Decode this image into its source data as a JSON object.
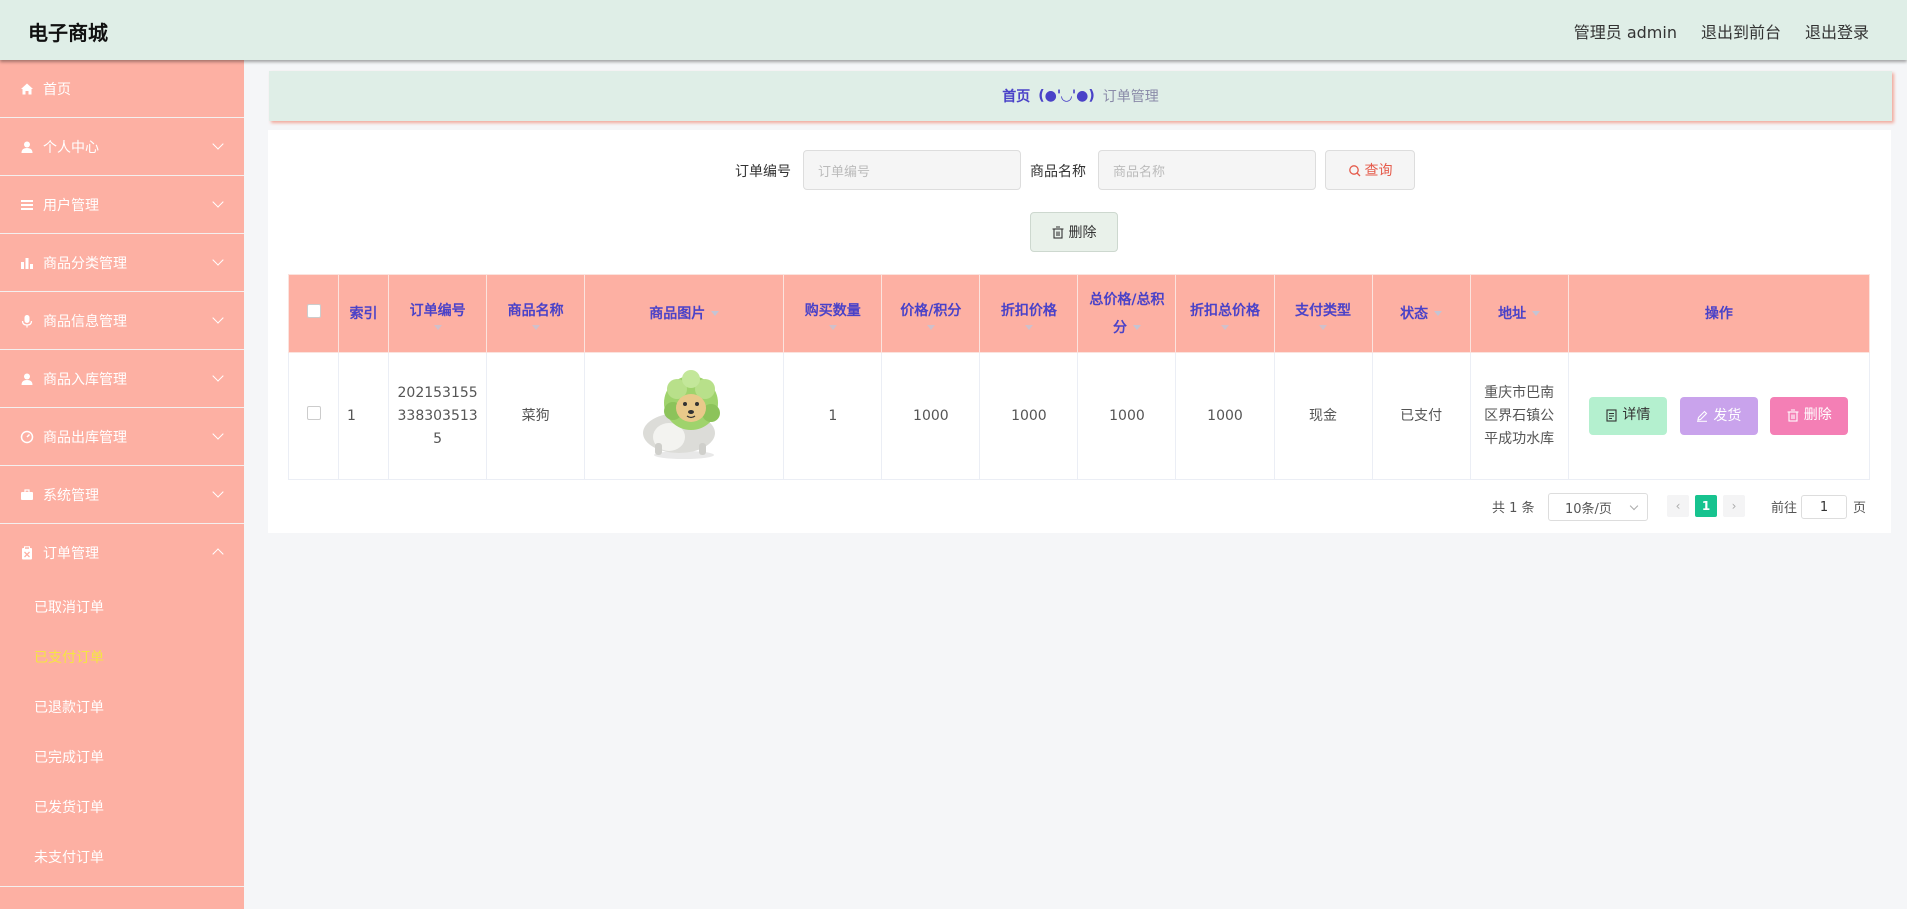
{
  "header": {
    "brand": "电子商城",
    "admin_label": "管理员 admin",
    "to_front_label": "退出到前台",
    "logout_label": "退出登录"
  },
  "sidebar": {
    "items": [
      {
        "label": "首页",
        "icon": "home-icon",
        "has_chevron": false
      },
      {
        "label": "个人中心",
        "icon": "user-icon",
        "has_chevron": true
      },
      {
        "label": "用户管理",
        "icon": "list-icon",
        "has_chevron": true
      },
      {
        "label": "商品分类管理",
        "icon": "bar-chart-icon",
        "has_chevron": true
      },
      {
        "label": "商品信息管理",
        "icon": "microphone-icon",
        "has_chevron": true
      },
      {
        "label": "商品入库管理",
        "icon": "user-icon",
        "has_chevron": true
      },
      {
        "label": "商品出库管理",
        "icon": "gauge-icon",
        "has_chevron": true
      },
      {
        "label": "系统管理",
        "icon": "briefcase-icon",
        "has_chevron": true
      },
      {
        "label": "订单管理",
        "icon": "clipboard-icon",
        "has_chevron": true
      }
    ],
    "order_sub_items": [
      "已取消订单",
      "已支付订单",
      "已退款订单",
      "已完成订单",
      "已发货订单",
      "未支付订单"
    ],
    "active_sub_item": "已支付订单"
  },
  "breadcrumb": {
    "home": "首页",
    "separator": "(●'◡'●)",
    "current": "订单管理"
  },
  "search": {
    "order_no_label": "订单编号",
    "order_no_placeholder": "订单编号",
    "product_name_label": "商品名称",
    "product_name_placeholder": "商品名称",
    "query_button": "查询",
    "delete_button": "删除"
  },
  "table": {
    "columns": [
      "索引",
      "订单编号",
      "商品名称",
      "商品图片",
      "购买数量",
      "价格/积分",
      "折扣价格",
      "总价格/总积分",
      "折扣总价格",
      "支付类型",
      "状态",
      "地址",
      "操作"
    ],
    "rows": [
      {
        "index": "1",
        "order_no": "2021531553383035135",
        "product_name": "菜狗",
        "image_alt": "cabbage-dog-image",
        "quantity": "1",
        "price": "1000",
        "discount_price": "1000",
        "total_price": "1000",
        "discount_total": "1000",
        "pay_type": "现金",
        "status": "已支付",
        "address": "重庆市巴南区界石镇公平成功水库",
        "actions": {
          "detail": "详情",
          "ship": "发货",
          "delete": "删除"
        }
      }
    ]
  },
  "pagination": {
    "total_text": "共 1 条",
    "page_size": "10条/页",
    "current_page": "1",
    "goto_prefix": "前往",
    "goto_value": "1",
    "goto_suffix": "页"
  },
  "colors": {
    "header_bg": "#dfeee7",
    "sidebar_bg": "#fdb0a3",
    "table_header_bg": "#fdb0a3",
    "header_text": "#4a42c8",
    "active_sub": "#f5e642",
    "current_page": "#17c38f"
  }
}
